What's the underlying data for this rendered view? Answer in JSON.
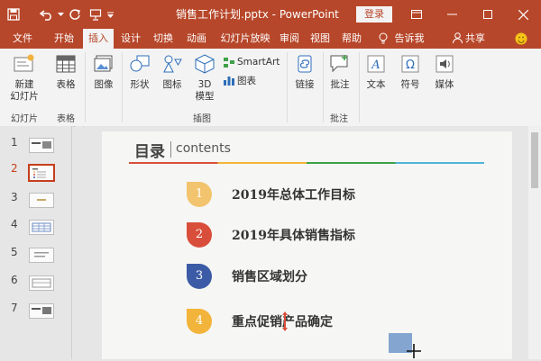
{
  "window": {
    "title": "销售工作计划.pptx - PowerPoint",
    "login_label": "登录"
  },
  "tabs": [
    "文件",
    "开始",
    "插入",
    "设计",
    "切换",
    "动画",
    "幻灯片放映",
    "审阅",
    "视图",
    "帮助",
    "告诉我",
    "共享"
  ],
  "active_tab": "插入",
  "ribbon": {
    "new_slide": "新建\n幻灯片",
    "table": "表格",
    "image": "图像",
    "shapes": "形状",
    "icons": "图标",
    "models_3d": "3D\n模型",
    "smartart": "SmartArt",
    "chart": "图表",
    "link": "链接",
    "comment": "批注",
    "text": "文本",
    "symbol": "符号",
    "media": "媒体",
    "groups": {
      "slides": "幻灯片",
      "tables": "表格",
      "illustrations": "插图",
      "comments": "批注"
    }
  },
  "thumbnails": [
    "1",
    "2",
    "3",
    "4",
    "5",
    "6",
    "7"
  ],
  "selected_slide": "2",
  "slide": {
    "heading": "目录",
    "subheading": "contents",
    "items": [
      {
        "num": "1",
        "text": "2019年总体工作目标",
        "color": "#f2c46d"
      },
      {
        "num": "2",
        "text": "2019年具体销售指标",
        "color": "#d94e3a"
      },
      {
        "num": "3",
        "text": "销售区域划分",
        "color": "#3c5ba6"
      },
      {
        "num": "4",
        "text": "重点促销产品确定",
        "color": "#f2b43a"
      }
    ]
  },
  "colors": {
    "accent": "#b7472a",
    "ribbon_bg": "#f3f3f3",
    "selection": "#c43e1c"
  }
}
